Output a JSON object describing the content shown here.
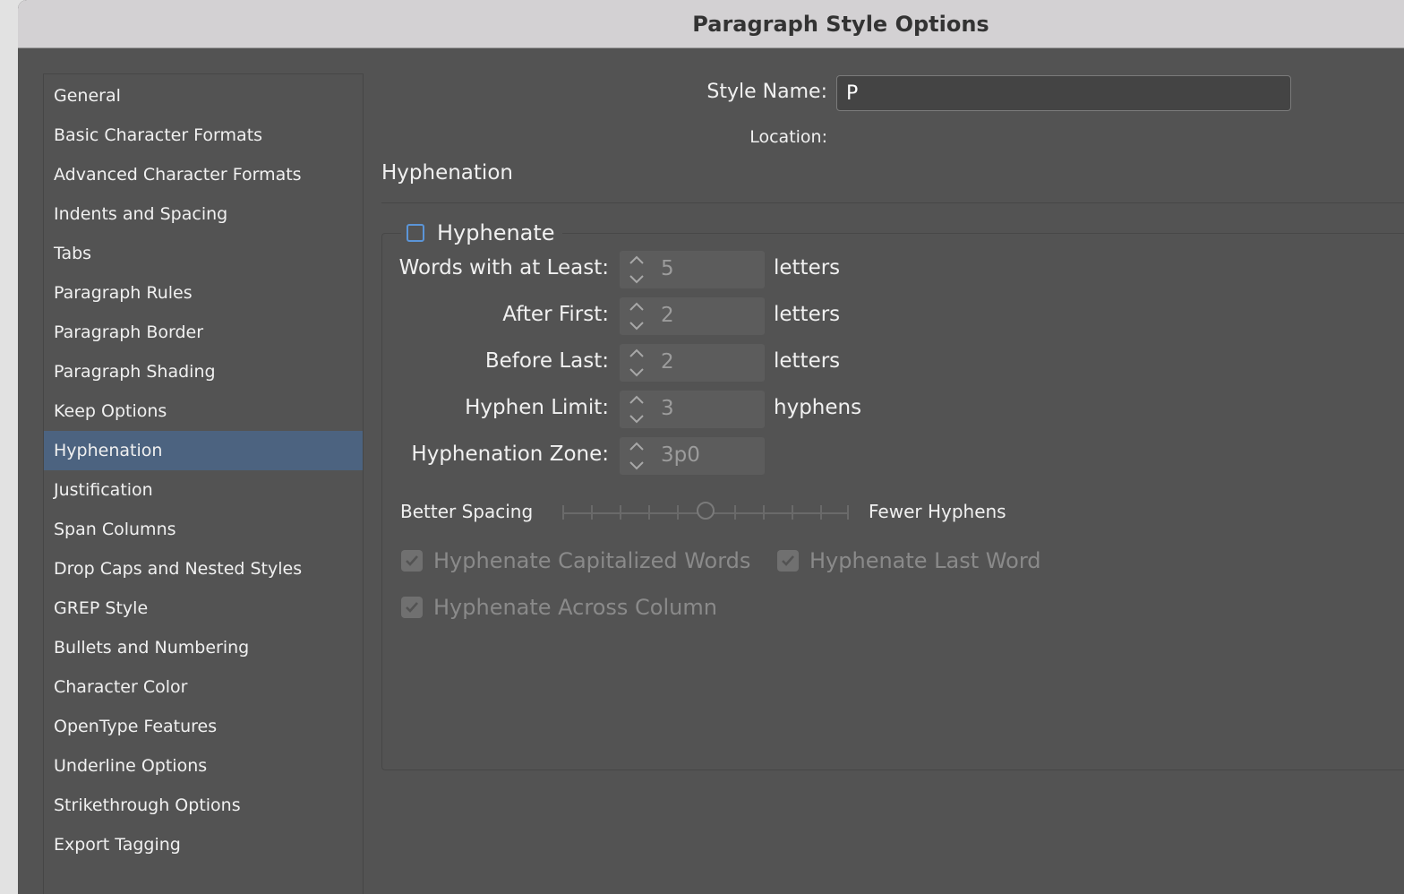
{
  "window": {
    "title": "Paragraph Style Options"
  },
  "sidebar": {
    "items": [
      {
        "label": "General"
      },
      {
        "label": "Basic Character Formats"
      },
      {
        "label": "Advanced Character Formats"
      },
      {
        "label": "Indents and Spacing"
      },
      {
        "label": "Tabs"
      },
      {
        "label": "Paragraph Rules"
      },
      {
        "label": "Paragraph Border"
      },
      {
        "label": "Paragraph Shading"
      },
      {
        "label": "Keep Options"
      },
      {
        "label": "Hyphenation",
        "selected": true
      },
      {
        "label": "Justification"
      },
      {
        "label": "Span Columns"
      },
      {
        "label": "Drop Caps and Nested Styles"
      },
      {
        "label": "GREP Style"
      },
      {
        "label": "Bullets and Numbering"
      },
      {
        "label": "Character Color"
      },
      {
        "label": "OpenType Features"
      },
      {
        "label": "Underline Options"
      },
      {
        "label": "Strikethrough Options"
      },
      {
        "label": "Export Tagging"
      }
    ]
  },
  "header": {
    "style_name_label": "Style Name:",
    "style_name_value": "P",
    "location_label": "Location:"
  },
  "section": {
    "title": "Hyphenation"
  },
  "hyphenate": {
    "label": "Hyphenate",
    "checked": false
  },
  "fields": [
    {
      "label": "Words with at Least:",
      "value": "5",
      "unit": "letters"
    },
    {
      "label": "After First:",
      "value": "2",
      "unit": "letters"
    },
    {
      "label": "Before Last:",
      "value": "2",
      "unit": "letters"
    },
    {
      "label": "Hyphen Limit:",
      "value": "3",
      "unit": "hyphens"
    },
    {
      "label": "Hyphenation Zone:",
      "value": "3p0",
      "unit": ""
    }
  ],
  "slider": {
    "left_label": "Better Spacing",
    "right_label": "Fewer Hyphens",
    "position": 0.5
  },
  "options": {
    "capitalized": {
      "label": "Hyphenate Capitalized Words",
      "checked": true
    },
    "last_word": {
      "label": "Hyphenate Last Word",
      "checked": true
    },
    "across_column": {
      "label": "Hyphenate Across Column",
      "checked": true
    }
  },
  "colors": {
    "selected": "#4c6380",
    "panel": "#535353",
    "checkbox_accent": "#5b95d8"
  }
}
